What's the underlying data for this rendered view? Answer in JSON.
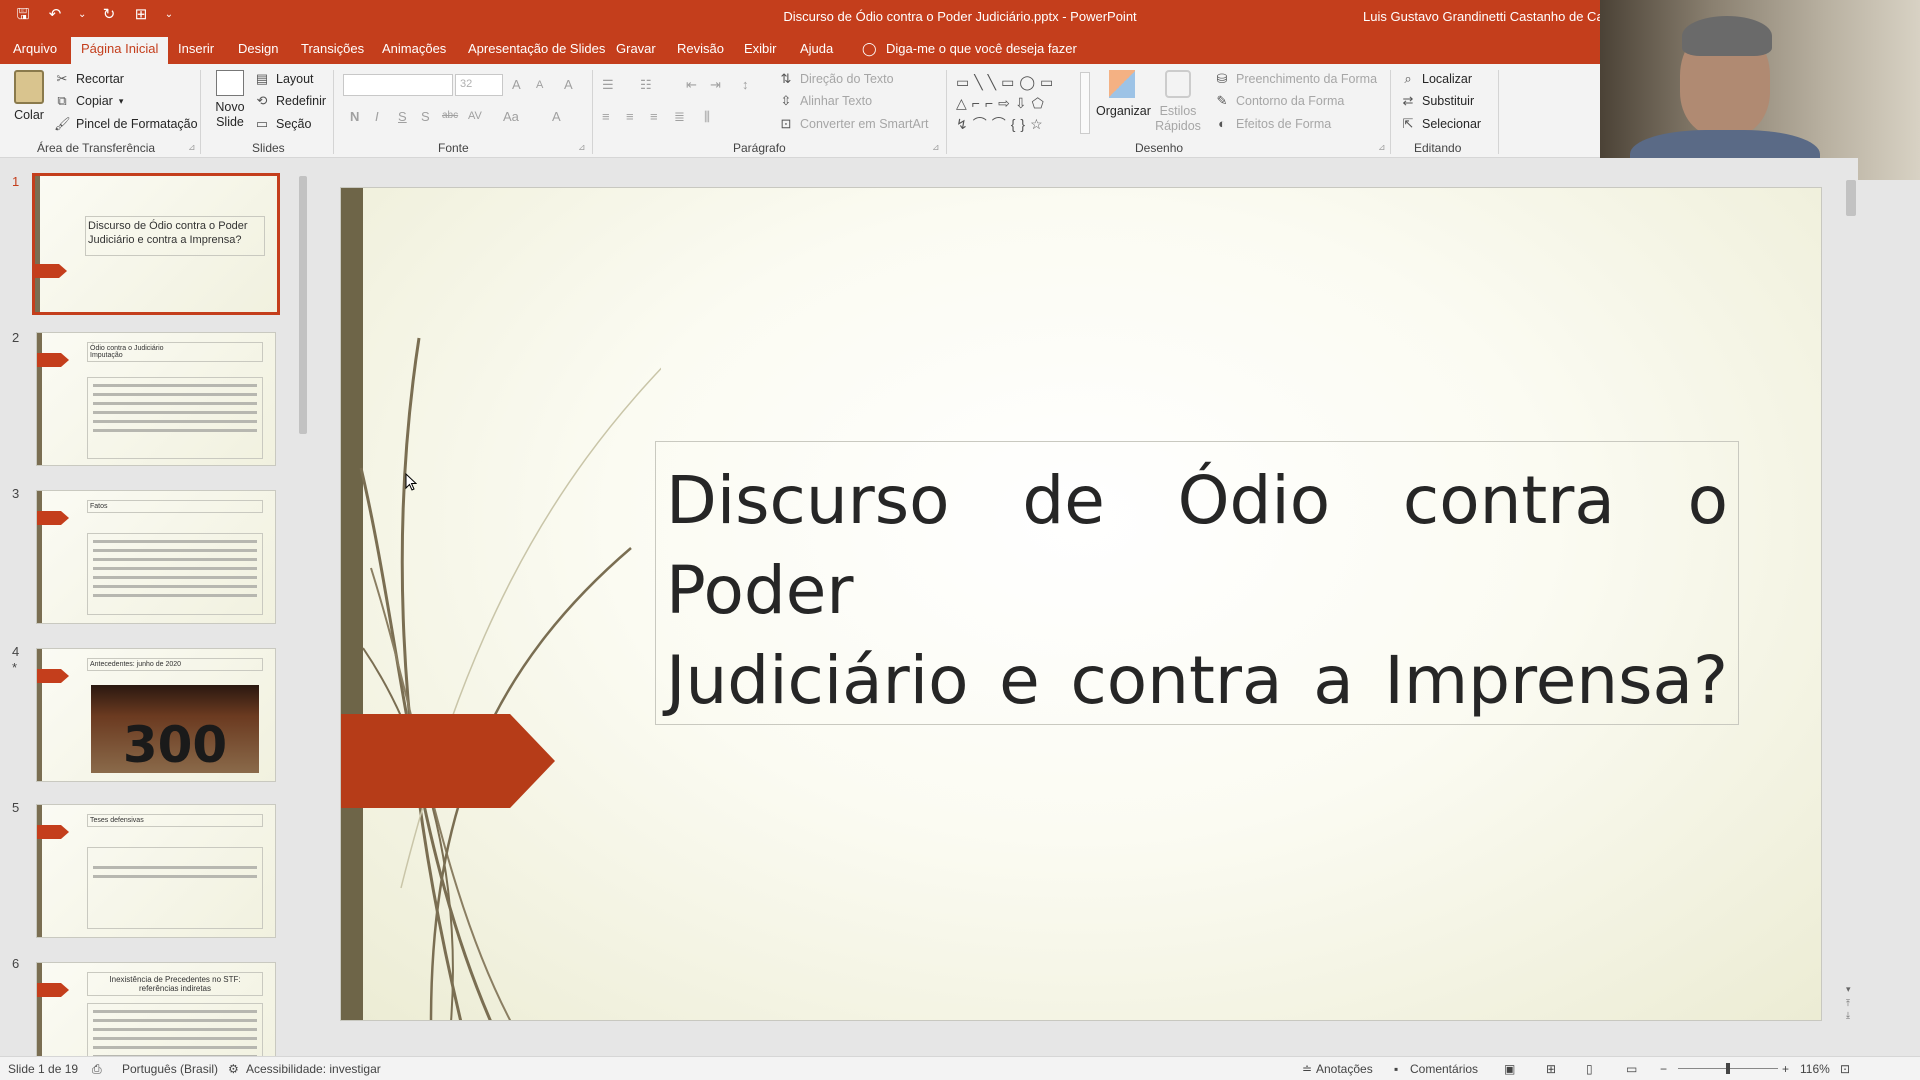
{
  "app": {
    "title": "Discurso de Ódio contra o Poder Judiciário.pptx  -  PowerPoint",
    "user": "Luis Gustavo Grandinetti Castanho de Car",
    "accent": "#c43e1c"
  },
  "qat": {
    "save": "🖫",
    "undo": "↶",
    "undo_menu": "⌄",
    "redo": "↻",
    "present": "⊞",
    "more": "⌄"
  },
  "tabs": [
    "Arquivo",
    "Página Inicial",
    "Inserir",
    "Design",
    "Transições",
    "Animações",
    "Apresentação de Slides",
    "Gravar",
    "Revisão",
    "Exibir",
    "Ajuda"
  ],
  "tell_me": "Diga-me o que você deseja fazer",
  "ribbon": {
    "clipboard": {
      "paste": "Colar",
      "cut": "Recortar",
      "copy": "Copiar",
      "format_painter": "Pincel de Formatação",
      "label": "Área de Transferência"
    },
    "slides": {
      "new_slide_1": "Novo",
      "new_slide_2": "Slide",
      "layout": "Layout",
      "reset": "Redefinir",
      "section": "Seção",
      "label": "Slides"
    },
    "font": {
      "size": "32",
      "bold": "N",
      "italic": "I",
      "underline": "S",
      "shadow": "S",
      "strike": "abc",
      "spacing": "AV",
      "case": "Aa",
      "color": "A",
      "grow": "A",
      "shrink": "A",
      "clear": "A",
      "label": "Fonte"
    },
    "paragraph": {
      "text_direction": "Direção do Texto",
      "align_text": "Alinhar Texto",
      "smartart": "Converter em SmartArt",
      "label": "Parágrafo"
    },
    "drawing": {
      "arrange": "Organizar",
      "quick_styles_1": "Estilos",
      "quick_styles_2": "Rápidos",
      "fill": "Preenchimento da Forma",
      "outline": "Contorno da Forma",
      "effects": "Efeitos de Forma",
      "label": "Desenho"
    },
    "editing": {
      "find": "Localizar",
      "replace": "Substituir",
      "select": "Selecionar",
      "label": "Editando"
    }
  },
  "thumbnails": [
    {
      "num": "1",
      "title": "Discurso de Ódio contra o Poder Judiciário e contra a Imprensa?"
    },
    {
      "num": "2",
      "title": "Ódio contra o Judiciário",
      "sub": "Imputação"
    },
    {
      "num": "3",
      "title": "Fatos"
    },
    {
      "num": "4",
      "star": "*",
      "title": "Antecedentes: junho de 2020",
      "image_text": "300"
    },
    {
      "num": "5",
      "title": "Teses defensivas"
    },
    {
      "num": "6",
      "title": "Inexistência de Precedentes no STF: referências indiretas"
    }
  ],
  "slide": {
    "title_line1": "Discurso de Ódio contra o Poder",
    "title_line2": "Judiciário e contra a Imprensa?"
  },
  "status": {
    "slide_of": "Slide 1 de 19",
    "language": "Português (Brasil)",
    "accessibility": "Acessibilidade: investigar",
    "notes": "Anotações",
    "comments": "Comentários",
    "zoom": "116%"
  }
}
